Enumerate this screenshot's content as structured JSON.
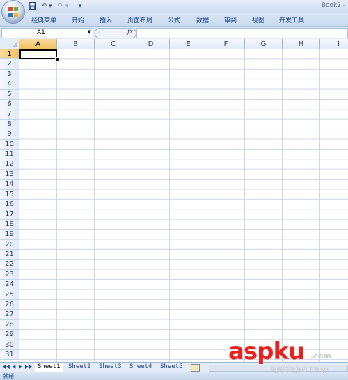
{
  "window": {
    "title": "Book2 -"
  },
  "quick_access": {
    "undo_icon": "undo-icon",
    "redo_icon": "redo-icon",
    "customize": "▾"
  },
  "ribbon": {
    "tabs": [
      {
        "label": "经典菜单"
      },
      {
        "label": "开始"
      },
      {
        "label": "插入"
      },
      {
        "label": "页面布局"
      },
      {
        "label": "公式"
      },
      {
        "label": "数据"
      },
      {
        "label": "审阅"
      },
      {
        "label": "视图"
      },
      {
        "label": "开发工具"
      }
    ]
  },
  "formula_bar": {
    "name_box": "A1",
    "fx_label": "fx",
    "formula": ""
  },
  "grid": {
    "columns": [
      "A",
      "B",
      "C",
      "D",
      "E",
      "F",
      "G",
      "H",
      "I"
    ],
    "rows": [
      "1",
      "2",
      "3",
      "4",
      "5",
      "6",
      "7",
      "8",
      "9",
      "10",
      "11",
      "12",
      "13",
      "14",
      "15",
      "16",
      "17",
      "18",
      "19",
      "20",
      "21",
      "22",
      "23",
      "24",
      "25",
      "26",
      "27",
      "28",
      "29",
      "30",
      "31"
    ],
    "active_cell": "A1"
  },
  "sheets": {
    "tabs": [
      "Sheet1",
      "Sheet2",
      "Sheet3",
      "Sheet4",
      "Sheet5"
    ],
    "active": "Sheet1",
    "nav": [
      "◀◀",
      "◀",
      "▶",
      "▶▶"
    ]
  },
  "status": {
    "text": "就绪"
  },
  "watermark": {
    "logo": "aspku",
    "suffix": ".com",
    "subtitle": "免费网站源码下载站!"
  },
  "colors": {
    "accent": "#15428b",
    "selected_header": "#f1c15f",
    "watermark": "#e8231f"
  }
}
